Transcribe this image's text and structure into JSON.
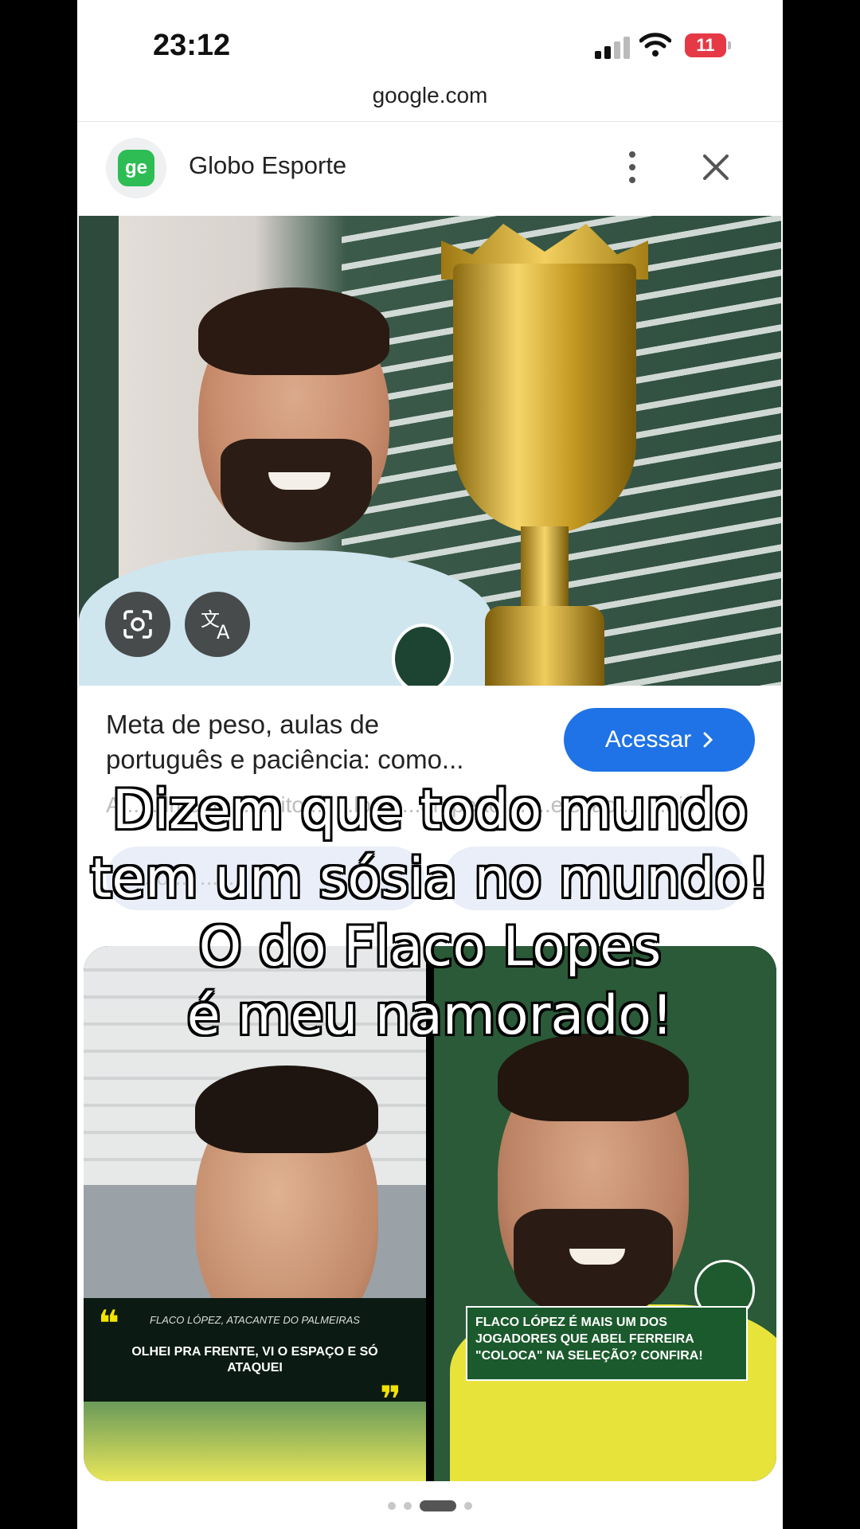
{
  "status_bar": {
    "time": "23:12",
    "battery": "11"
  },
  "browser": {
    "url": "google.com"
  },
  "source": {
    "logo_text": "ge",
    "name": "Globo Esporte"
  },
  "article": {
    "headline_line1": "Meta de peso, aulas de",
    "headline_line2": "português e paciência: como...",
    "cta_label": "Acessar",
    "snippet": "A... ...lmente ... ...ito ... ...lo ... ...ampeão ... ...eleção ... ...ais",
    "chip_label": "...o ... ...ll..."
  },
  "related": {
    "left_caption": "FLACO LÓPEZ, ATACANTE DO PALMEIRAS",
    "left_quote": "OLHEI PRA FRENTE, VI O ESPAÇO E SÓ ATAQUEI",
    "right_headline": "FLACO LÓPEZ É MAIS UM DOS JOGADORES QUE ABEL FERREIRA \"COLOCA\" NA SELEÇÃO? CONFIRA!"
  },
  "overlay": {
    "line1": "Dizem que todo mundo",
    "line2": "tem um sósia no mundo!",
    "line3": "O do Flaco Lopes",
    "line4": "é meu namorado!"
  },
  "pagination": {
    "total": 4,
    "active_index": 2
  },
  "colors": {
    "accent": "#1f73e6",
    "ge_green": "#2dbd54",
    "battery_low": "#e53945"
  }
}
